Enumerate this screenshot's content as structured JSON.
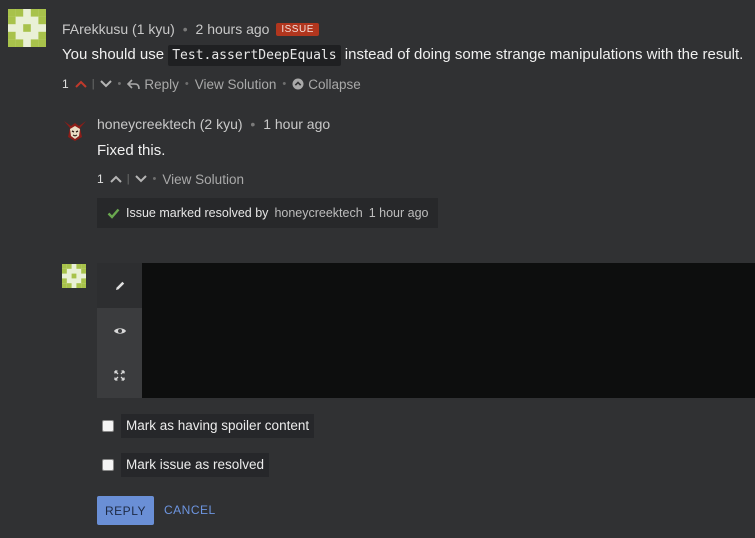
{
  "comment": {
    "user": "FArekkusu",
    "rank": "(1 kyu)",
    "time": "2 hours ago",
    "badge": "ISSUE",
    "text_before": "You should use",
    "code": "Test.assertDeepEquals",
    "text_after": "instead of doing some strange manipulations with the result.",
    "votes": "1",
    "reply_label": "Reply",
    "view_solution_label": "View Solution",
    "collapse_label": "Collapse"
  },
  "reply": {
    "user": "honeycreektech",
    "rank": "(2 kyu)",
    "time": "1 hour ago",
    "text": "Fixed this.",
    "votes": "1",
    "view_solution_label": "View Solution",
    "resolved_text": "Issue marked resolved by",
    "resolved_by": "honeycreektech",
    "resolved_time": "1 hour ago"
  },
  "composer": {
    "tools": [
      "pencil-icon",
      "eye-icon",
      "expand-icon"
    ],
    "spoiler_label": "Mark as having spoiler content",
    "resolve_label": "Mark issue as resolved",
    "reply_button": "REPLY",
    "cancel_button": "CANCEL"
  },
  "colors": {
    "background": "#303133",
    "issue_badge": "#b1361e",
    "upvote": "#c0392b",
    "resolved_check": "#6aa84f",
    "primary_button": "#6a8fd6",
    "link": "#6d95e0",
    "editor_bg": "#0d0e0e"
  }
}
